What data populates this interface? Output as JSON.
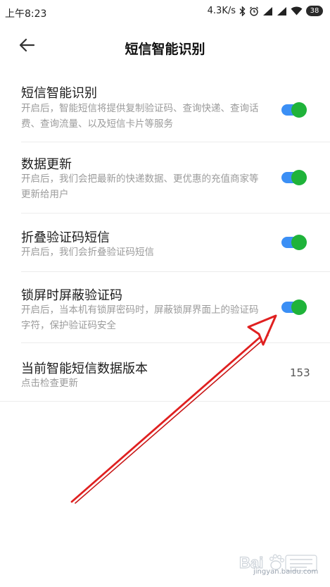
{
  "status_bar": {
    "time": "上午8:23",
    "speed": "4.3K/s",
    "battery": "38"
  },
  "header": {
    "title": "短信智能识别"
  },
  "settings": [
    {
      "title": "短信智能识别",
      "desc": "开启后，智能短信将提供复制验证码、查询快递、查询话费、查询流量、以及短信卡片等服务",
      "enabled": true
    },
    {
      "title": "数据更新",
      "desc": "开启后，我们会把最新的快递数据、更优惠的充值商家等更新给用户",
      "enabled": true
    },
    {
      "title": "折叠验证码短信",
      "desc": "开启后，我们会折叠验证码短信",
      "enabled": true
    },
    {
      "title": "锁屏时屏蔽验证码",
      "desc": "开启后，当本机有锁屏密码时，屏蔽锁屏界面上的验证码字符，保护验证码安全",
      "enabled": true
    }
  ],
  "version_row": {
    "title": "当前智能短信数据版本",
    "desc": "点击检查更新",
    "value": "153"
  },
  "colors": {
    "toggle_track": "#3b8ff5",
    "toggle_knob": "#1fb33a",
    "annotation_arrow": "#e02020"
  },
  "icons": [
    "back-arrow-icon",
    "bluetooth-icon",
    "alarm-icon",
    "signal-icon",
    "wifi-icon",
    "battery-icon"
  ],
  "watermark": {
    "text": "jingyan.baidu.com"
  }
}
